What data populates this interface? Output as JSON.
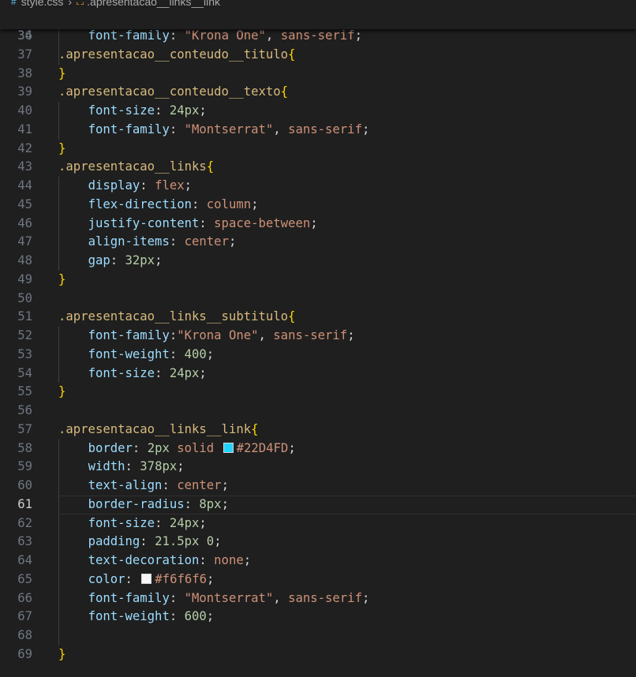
{
  "breadcrumb": {
    "file": "style.css",
    "symbol": ".apresentacao__links__link"
  },
  "sticky_line": {
    "number": "34",
    "tokens": [
      [
        "sel",
        ".apresentacao__conteudo__titulo"
      ],
      [
        "br",
        "{"
      ]
    ]
  },
  "active_line": "61",
  "lines": [
    {
      "n": "36",
      "g": 1,
      "t": [
        [
          "p",
          "    "
        ],
        [
          "prop",
          "font-family"
        ],
        [
          "p",
          ": "
        ],
        [
          "str",
          "\"Krona One\""
        ],
        [
          "p",
          ", "
        ],
        [
          "str",
          "sans-serif"
        ],
        [
          "p",
          ";"
        ]
      ]
    },
    {
      "n": "37",
      "g": 1,
      "t": []
    },
    {
      "n": "38",
      "g": 0,
      "t": [
        [
          "br",
          "}"
        ]
      ]
    },
    {
      "n": "39",
      "g": 0,
      "t": [
        [
          "sel",
          ".apresentacao__conteudo__texto"
        ],
        [
          "br",
          "{"
        ]
      ]
    },
    {
      "n": "40",
      "g": 1,
      "t": [
        [
          "p",
          "    "
        ],
        [
          "prop",
          "font-size"
        ],
        [
          "p",
          ": "
        ],
        [
          "num",
          "24px"
        ],
        [
          "p",
          ";"
        ]
      ]
    },
    {
      "n": "41",
      "g": 1,
      "t": [
        [
          "p",
          "    "
        ],
        [
          "prop",
          "font-family"
        ],
        [
          "p",
          ": "
        ],
        [
          "str",
          "\"Montserrat\""
        ],
        [
          "p",
          ", "
        ],
        [
          "str",
          "sans-serif"
        ],
        [
          "p",
          ";"
        ]
      ]
    },
    {
      "n": "42",
      "g": 0,
      "t": [
        [
          "br",
          "}"
        ]
      ]
    },
    {
      "n": "43",
      "g": 0,
      "t": [
        [
          "sel",
          ".apresentacao__links"
        ],
        [
          "br",
          "{"
        ]
      ]
    },
    {
      "n": "44",
      "g": 1,
      "t": [
        [
          "p",
          "    "
        ],
        [
          "prop",
          "display"
        ],
        [
          "p",
          ": "
        ],
        [
          "str",
          "flex"
        ],
        [
          "p",
          ";"
        ]
      ]
    },
    {
      "n": "45",
      "g": 1,
      "t": [
        [
          "p",
          "    "
        ],
        [
          "prop",
          "flex-direction"
        ],
        [
          "p",
          ": "
        ],
        [
          "str",
          "column"
        ],
        [
          "p",
          ";"
        ]
      ]
    },
    {
      "n": "46",
      "g": 1,
      "t": [
        [
          "p",
          "    "
        ],
        [
          "prop",
          "justify-content"
        ],
        [
          "p",
          ": "
        ],
        [
          "str",
          "space-between"
        ],
        [
          "p",
          ";"
        ]
      ]
    },
    {
      "n": "47",
      "g": 1,
      "t": [
        [
          "p",
          "    "
        ],
        [
          "prop",
          "align-items"
        ],
        [
          "p",
          ": "
        ],
        [
          "str",
          "center"
        ],
        [
          "p",
          ";"
        ]
      ]
    },
    {
      "n": "48",
      "g": 1,
      "t": [
        [
          "p",
          "    "
        ],
        [
          "prop",
          "gap"
        ],
        [
          "p",
          ": "
        ],
        [
          "num",
          "32px"
        ],
        [
          "p",
          ";"
        ]
      ]
    },
    {
      "n": "49",
      "g": 0,
      "t": [
        [
          "br",
          "}"
        ]
      ]
    },
    {
      "n": "50",
      "g": 0,
      "t": []
    },
    {
      "n": "51",
      "g": 0,
      "t": [
        [
          "sel",
          ".apresentacao__links__subtitulo"
        ],
        [
          "br",
          "{"
        ]
      ]
    },
    {
      "n": "52",
      "g": 1,
      "t": [
        [
          "p",
          "    "
        ],
        [
          "prop",
          "font-family"
        ],
        [
          "p",
          ":"
        ],
        [
          "str",
          "\"Krona One\""
        ],
        [
          "p",
          ", "
        ],
        [
          "str",
          "sans-serif"
        ],
        [
          "p",
          ";"
        ]
      ]
    },
    {
      "n": "53",
      "g": 1,
      "t": [
        [
          "p",
          "    "
        ],
        [
          "prop",
          "font-weight"
        ],
        [
          "p",
          ": "
        ],
        [
          "num",
          "400"
        ],
        [
          "p",
          ";"
        ]
      ]
    },
    {
      "n": "54",
      "g": 1,
      "t": [
        [
          "p",
          "    "
        ],
        [
          "prop",
          "font-size"
        ],
        [
          "p",
          ": "
        ],
        [
          "num",
          "24px"
        ],
        [
          "p",
          ";"
        ]
      ]
    },
    {
      "n": "55",
      "g": 0,
      "t": [
        [
          "br",
          "}"
        ]
      ]
    },
    {
      "n": "56",
      "g": 0,
      "t": []
    },
    {
      "n": "57",
      "g": 0,
      "t": [
        [
          "sel",
          ".apresentacao__links__link"
        ],
        [
          "br",
          "{"
        ]
      ]
    },
    {
      "n": "58",
      "g": 1,
      "t": [
        [
          "p",
          "    "
        ],
        [
          "prop",
          "border"
        ],
        [
          "p",
          ": "
        ],
        [
          "num",
          "2px"
        ],
        [
          "p",
          " "
        ],
        [
          "str",
          "solid"
        ],
        [
          "p",
          " "
        ],
        [
          "sw",
          "#22D4FD"
        ],
        [
          "str",
          "#22D4FD"
        ],
        [
          "p",
          ";"
        ]
      ]
    },
    {
      "n": "59",
      "g": 1,
      "t": [
        [
          "p",
          "    "
        ],
        [
          "prop",
          "width"
        ],
        [
          "p",
          ": "
        ],
        [
          "num",
          "378px"
        ],
        [
          "p",
          ";"
        ]
      ]
    },
    {
      "n": "60",
      "g": 1,
      "t": [
        [
          "p",
          "    "
        ],
        [
          "prop",
          "text-align"
        ],
        [
          "p",
          ": "
        ],
        [
          "str",
          "center"
        ],
        [
          "p",
          ";"
        ]
      ]
    },
    {
      "n": "61",
      "g": 1,
      "t": [
        [
          "p",
          "    "
        ],
        [
          "prop",
          "border-radius"
        ],
        [
          "p",
          ": "
        ],
        [
          "num",
          "8px"
        ],
        [
          "p",
          ";"
        ]
      ]
    },
    {
      "n": "62",
      "g": 1,
      "t": [
        [
          "p",
          "    "
        ],
        [
          "prop",
          "font-size"
        ],
        [
          "p",
          ": "
        ],
        [
          "num",
          "24px"
        ],
        [
          "p",
          ";"
        ]
      ]
    },
    {
      "n": "63",
      "g": 1,
      "t": [
        [
          "p",
          "    "
        ],
        [
          "prop",
          "padding"
        ],
        [
          "p",
          ": "
        ],
        [
          "num",
          "21.5px"
        ],
        [
          "p",
          " "
        ],
        [
          "num",
          "0"
        ],
        [
          "p",
          ";"
        ]
      ]
    },
    {
      "n": "64",
      "g": 1,
      "t": [
        [
          "p",
          "    "
        ],
        [
          "prop",
          "text-decoration"
        ],
        [
          "p",
          ": "
        ],
        [
          "str",
          "none"
        ],
        [
          "p",
          ";"
        ]
      ]
    },
    {
      "n": "65",
      "g": 1,
      "t": [
        [
          "p",
          "    "
        ],
        [
          "prop",
          "color"
        ],
        [
          "p",
          ": "
        ],
        [
          "sw",
          "#f6f6f6"
        ],
        [
          "str",
          "#f6f6f6"
        ],
        [
          "p",
          ";"
        ]
      ]
    },
    {
      "n": "66",
      "g": 1,
      "t": [
        [
          "p",
          "    "
        ],
        [
          "prop",
          "font-family"
        ],
        [
          "p",
          ": "
        ],
        [
          "str",
          "\"Montserrat\""
        ],
        [
          "p",
          ", "
        ],
        [
          "str",
          "sans-serif"
        ],
        [
          "p",
          ";"
        ]
      ]
    },
    {
      "n": "67",
      "g": 1,
      "t": [
        [
          "p",
          "    "
        ],
        [
          "prop",
          "font-weight"
        ],
        [
          "p",
          ": "
        ],
        [
          "num",
          "600"
        ],
        [
          "p",
          ";"
        ]
      ]
    },
    {
      "n": "68",
      "g": 1,
      "t": []
    },
    {
      "n": "69",
      "g": 0,
      "t": [
        [
          "br",
          "}"
        ]
      ]
    }
  ]
}
